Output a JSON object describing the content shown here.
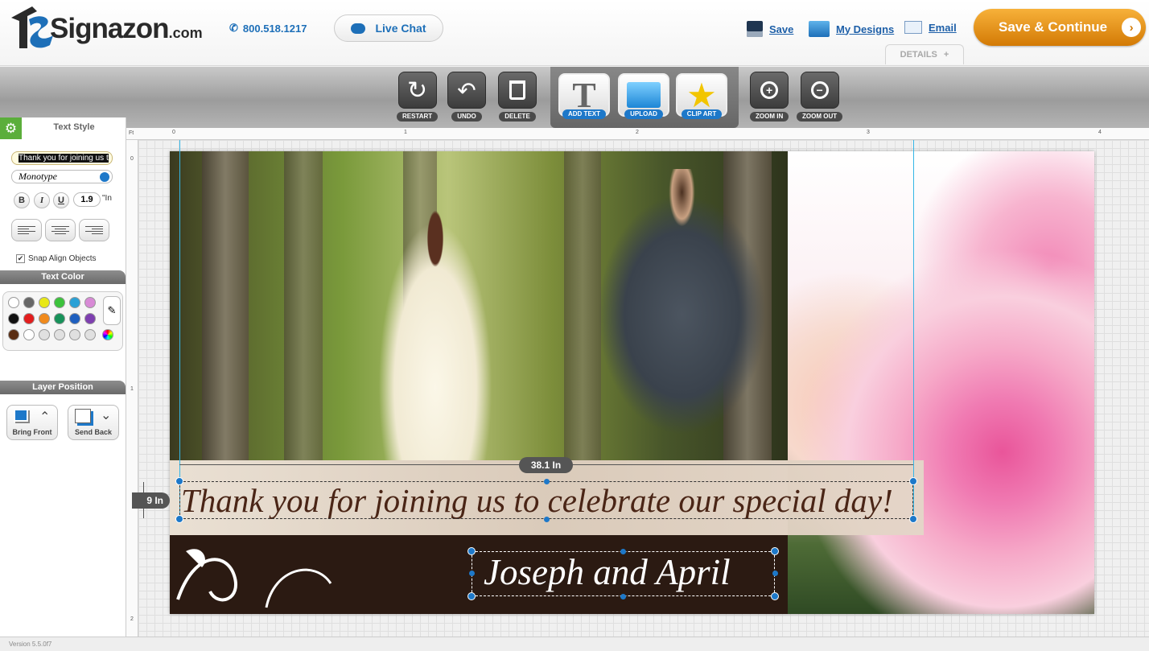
{
  "header": {
    "brand": "Signazon",
    "brand_suffix": ".com",
    "phone": "800.518.1217",
    "live_chat": "Live Chat",
    "save": "Save",
    "my_designs": "My Designs",
    "email": "Email",
    "save_continue": "Save & Continue",
    "details": "DETAILS",
    "details_plus": "+"
  },
  "toolbar": {
    "restart": "RESTART",
    "undo": "UNDO",
    "delete": "DELETE",
    "add_text": "ADD TEXT",
    "upload": "UPLOAD",
    "clip_art": "CLIP ART",
    "zoom_in": "ZOOM IN",
    "zoom_out": "ZOOM OUT"
  },
  "left_panel": {
    "text_style": "Text Style",
    "text_value": "Thank you for joining us t",
    "font": "Monotype",
    "bold": "B",
    "italic": "I",
    "underline": "U",
    "size": "1.9",
    "unit": "\"In",
    "snap": "Snap Align Objects",
    "snap_checked": true,
    "text_color": "Text Color",
    "layer_position": "Layer Position",
    "bring_front": "Bring Front",
    "send_back": "Send Back"
  },
  "palette": {
    "row1": [
      "#ffffff",
      "#666666",
      "#e8e817",
      "#3cc23c",
      "#2aa1d6",
      "#d88ad6"
    ],
    "row2": [
      "#111111",
      "#e21d1d",
      "#f08a1c",
      "#17925a",
      "#1e5fbf",
      "#7e3fb0"
    ],
    "row3": [
      "#5a2d12",
      "#ffffff",
      "#e0e0e0",
      "#e0e0e0",
      "#e0e0e0",
      "#e0e0e0"
    ]
  },
  "rulers": {
    "top": [
      "Ft",
      "0",
      "1",
      "2",
      "3",
      "4"
    ],
    "left": [
      "0",
      "1",
      "2"
    ]
  },
  "canvas": {
    "thanks": "Thank you for joining us to celebrate our special day!",
    "names": "Joseph and April",
    "width_label": "38.1 In",
    "height_label": "9 In"
  },
  "footer": {
    "version": "Version 5.5.0f7"
  }
}
